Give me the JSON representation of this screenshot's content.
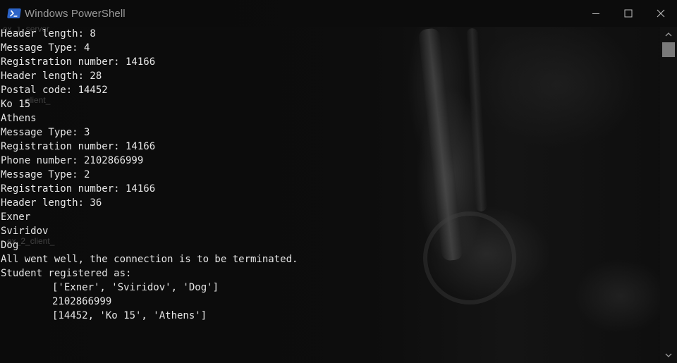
{
  "window": {
    "title": "Windows PowerShell",
    "icon": "powershell-icon",
    "controls": [
      "minimize-icon",
      "maximize-icon",
      "close-icon"
    ]
  },
  "background_labels": [
    "ex_1_server",
    "_client_",
    "ex_2_client_"
  ],
  "console": {
    "lines": [
      "Header length: 8",
      "Message Type: 4",
      "Registration number: 14166",
      "Header length: 28",
      "Postal code: 14452",
      "Ko 15",
      "Athens",
      "Message Type: 3",
      "Registration number: 14166",
      "Phone number: 2102866999",
      "Message Type: 2",
      "Registration number: 14166",
      "Header length: 36",
      "Exner",
      "Sviridov",
      "Dog",
      "All went well, the connection is to be terminated.",
      "Student registered as:"
    ],
    "indented_lines": [
      "['Exner', 'Sviridov', 'Dog']",
      "2102866999",
      "[14452, 'Ko 15', 'Athens']"
    ]
  },
  "scrollbar": {
    "position": 0.0
  },
  "colors": {
    "text": "#e6e6e6",
    "background": "#0c0c0c",
    "title_text": "#9a9a9a",
    "scroll_thumb": "#7a7a7a"
  }
}
